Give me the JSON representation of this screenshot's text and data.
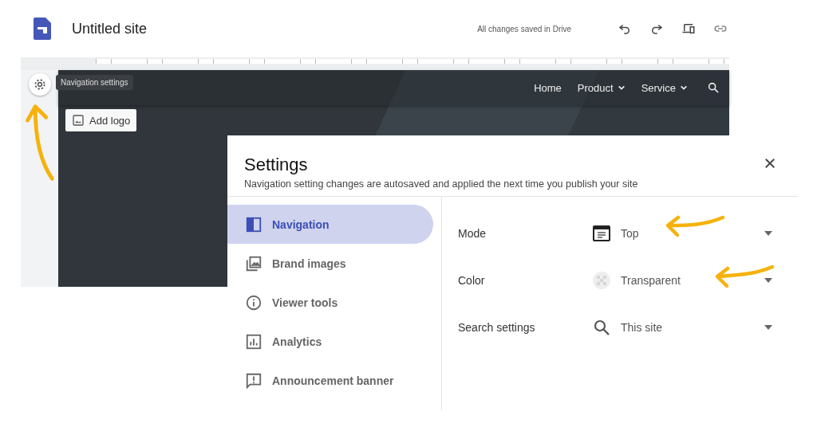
{
  "header": {
    "title": "Untitled site",
    "save_status": "All changes saved in Drive"
  },
  "site": {
    "add_logo": "Add logo",
    "tooltip": "Navigation settings",
    "menu": [
      {
        "label": "Home",
        "has_dropdown": false
      },
      {
        "label": "Product",
        "has_dropdown": true
      },
      {
        "label": "Service",
        "has_dropdown": true
      }
    ]
  },
  "dialog": {
    "title": "Settings",
    "subtitle": "Navigation setting changes are autosaved and applied the next time you publish your site",
    "nav": [
      {
        "label": "Navigation",
        "selected": true
      },
      {
        "label": "Brand images",
        "selected": false
      },
      {
        "label": "Viewer tools",
        "selected": false
      },
      {
        "label": "Analytics",
        "selected": false
      },
      {
        "label": "Announcement banner",
        "selected": false
      }
    ],
    "settings": [
      {
        "kind": "mode",
        "label": "Mode",
        "value": "Top"
      },
      {
        "kind": "color",
        "label": "Color",
        "value": "Transparent"
      },
      {
        "kind": "search",
        "label": "Search settings",
        "value": "This site"
      }
    ]
  }
}
